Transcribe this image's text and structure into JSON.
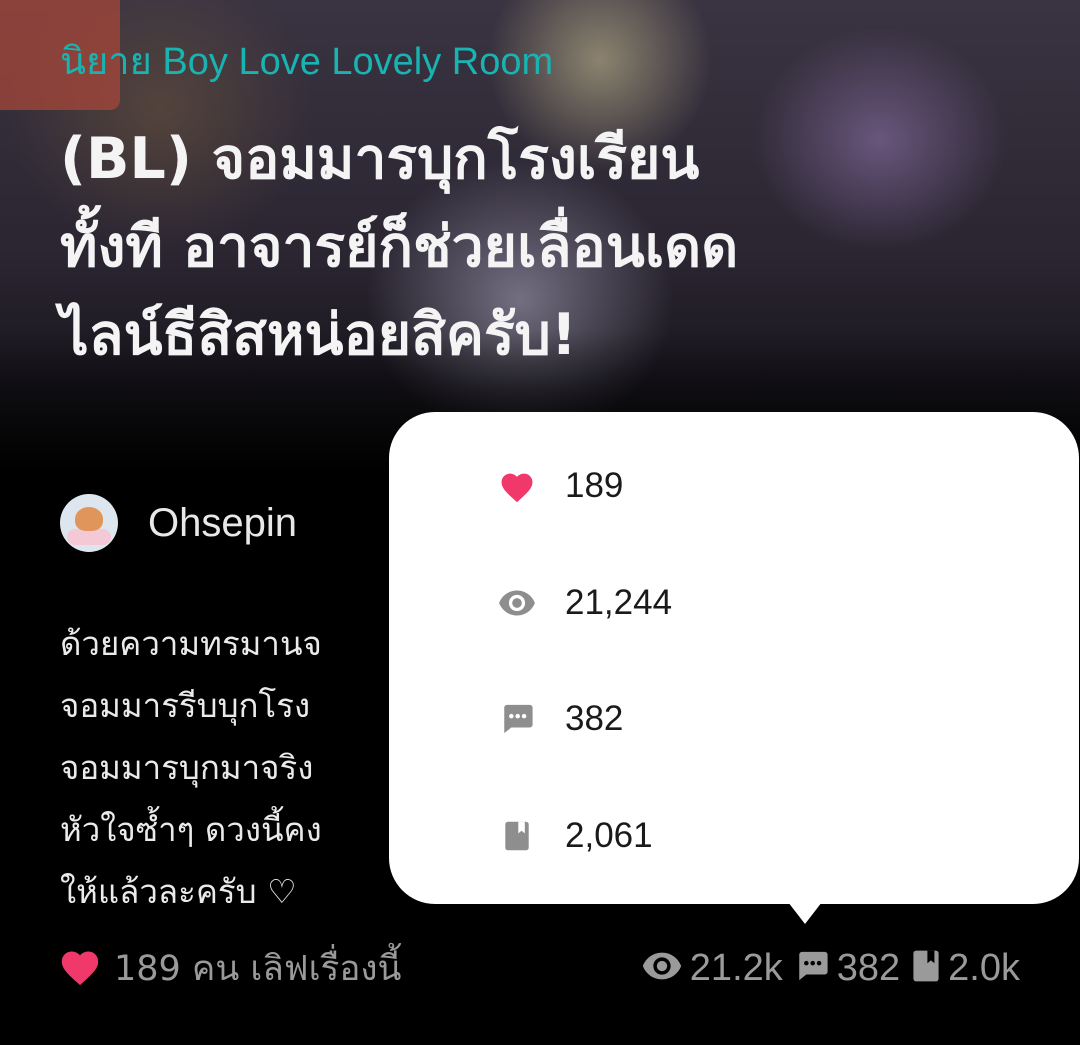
{
  "story": {
    "category": "นิยาย Boy Love Lovely Room",
    "title_lines": [
      "(BL) จอมมารบุกโรงเรียน",
      "ทั้งที อาจารย์ก็ช่วยเลื่อนเดด",
      "ไลน์ธีสิสหน่อยสิครับ!"
    ],
    "author": "Ohsepin",
    "description_lines": [
      "ด้วยความทรมานจ",
      "จอมมารรีบบุกโรง",
      "จอมมารบุกมาจริง",
      "หัวใจซ้ำๆ ดวงนี้คง",
      "ให้แล้วละครับ ♡"
    ]
  },
  "bottom_bar": {
    "love_text": "189 คน เลิฟเรื่องนี้",
    "views": "21.2k",
    "comments": "382",
    "chapters": "2.0k"
  },
  "popover": {
    "likes": "189",
    "views": "21,244",
    "comments": "382",
    "chapters": "2,061"
  },
  "colors": {
    "accent_teal": "#19b3b1",
    "heart_pink": "#f0386b",
    "muted_icon": "#9a9a9a",
    "popover_icon": "#8e8e8e"
  },
  "icons": [
    "heart-icon",
    "eye-icon",
    "comment-icon",
    "book-icon"
  ]
}
